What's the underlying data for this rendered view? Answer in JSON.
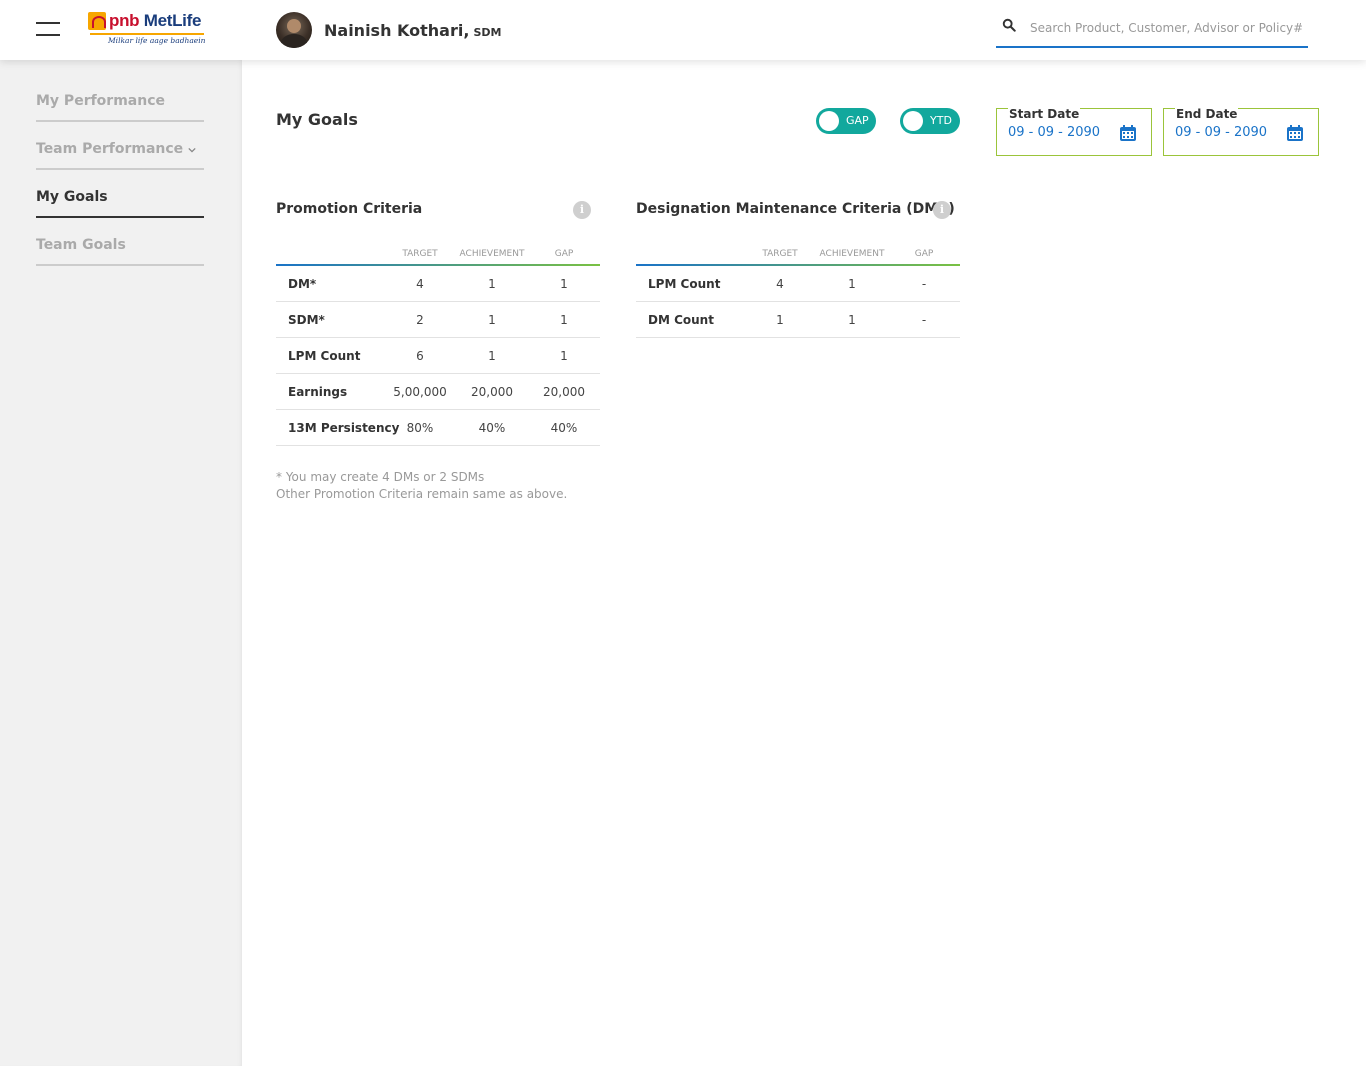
{
  "header": {
    "logo": {
      "brand_prefix": "pnb",
      "brand_name": "MetLife",
      "tagline": "Milkar life aage badhaein"
    },
    "user": {
      "name": "Nainish Kothari,",
      "role": "SDM"
    },
    "search": {
      "placeholder": "Search Product, Customer, Advisor or Policy#"
    }
  },
  "sidebar": {
    "items": [
      {
        "label": "My Performance",
        "active": false
      },
      {
        "label": "Team Performance",
        "active": false,
        "has_submenu": true
      },
      {
        "label": "My Goals",
        "active": true
      },
      {
        "label": "Team Goals",
        "active": false
      }
    ]
  },
  "main": {
    "title": "My Goals",
    "toggles": [
      {
        "label": "GAP",
        "on": true
      },
      {
        "label": "YTD",
        "on": true
      }
    ],
    "start_date": {
      "label": "Start Date",
      "value": "09 - 09 - 2090"
    },
    "end_date": {
      "label": "End Date",
      "value": "09 - 09 - 2090"
    },
    "promotion": {
      "title": "Promotion Criteria",
      "columns": [
        "TARGET",
        "ACHIEVEMENT",
        "GAP"
      ],
      "rows": [
        {
          "label": "DM*",
          "target": "4",
          "achievement": "1",
          "gap": "1"
        },
        {
          "label": "SDM*",
          "target": "2",
          "achievement": "1",
          "gap": "1"
        },
        {
          "label": "LPM Count",
          "target": "6",
          "achievement": "1",
          "gap": "1"
        },
        {
          "label": "Earnings",
          "target": "5,00,000",
          "achievement": "20,000",
          "gap": "20,000"
        },
        {
          "label": "13M Persistency",
          "target": "80%",
          "achievement": "40%",
          "gap": "40%"
        }
      ]
    },
    "dmc": {
      "title": "Designation Maintenance Criteria (DMC)",
      "columns": [
        "TARGET",
        "ACHIEVEMENT",
        "GAP"
      ],
      "rows": [
        {
          "label": "LPM Count",
          "target": "4",
          "achievement": "1",
          "gap": "-"
        },
        {
          "label": "DM Count",
          "target": "1",
          "achievement": "1",
          "gap": "-"
        }
      ]
    },
    "footnote": {
      "line1": "* You may create 4 DMs or 2 SDMs",
      "line2": "Other Promotion Criteria remain same as above."
    }
  },
  "colors": {
    "accent_teal": "#12a89d",
    "link_blue": "#1a73c8",
    "field_green": "#9bc43a",
    "sidebar_bg": "#f1f1f1"
  }
}
